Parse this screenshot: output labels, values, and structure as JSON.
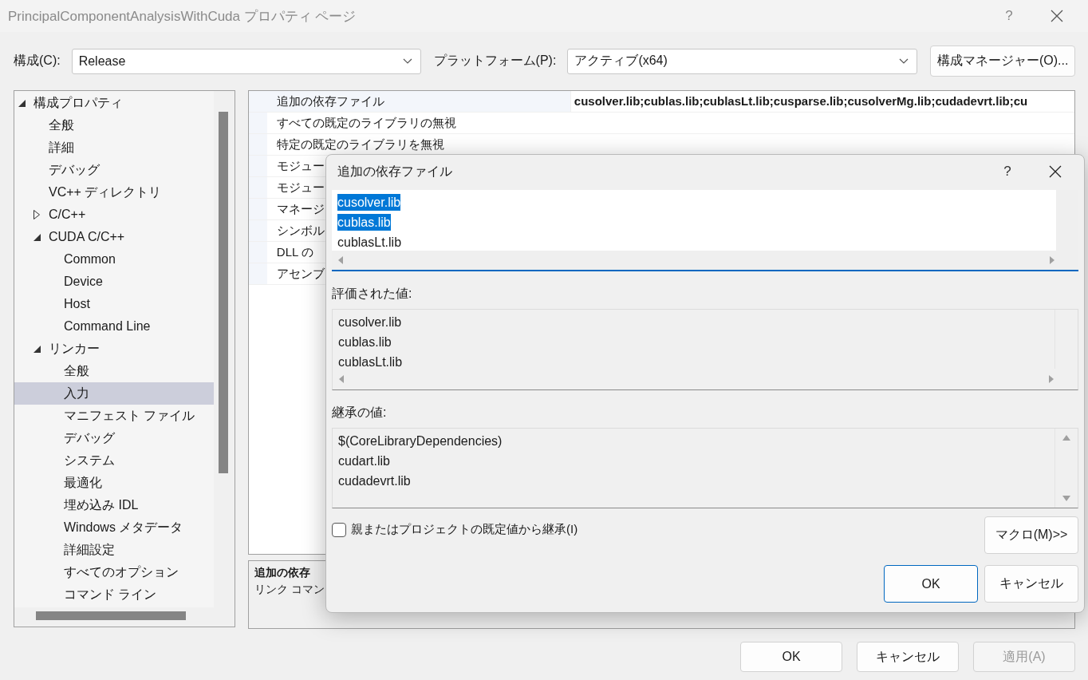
{
  "window": {
    "title": "PrincipalComponentAnalysisWithCuda プロパティ ページ",
    "help": "?"
  },
  "config": {
    "configuration_label": "構成(C):",
    "configuration": "Release",
    "platform_label": "プラットフォーム(P):",
    "platform": "アクティブ(x64)",
    "manager_button": "構成マネージャー(O)..."
  },
  "tree": [
    {
      "label": "構成プロパティ",
      "selected": false,
      "expanded": true,
      "children": [
        {
          "label": "全般",
          "selected": false
        },
        {
          "label": "詳細",
          "selected": false
        },
        {
          "label": "デバッグ",
          "selected": false
        },
        {
          "label": "VC++ ディレクトリ",
          "selected": false
        },
        {
          "label": "C/C++",
          "selected": false,
          "expanded": false
        },
        {
          "label": "CUDA C/C++",
          "selected": false,
          "expanded": true,
          "children": [
            {
              "label": "Common",
              "selected": false
            },
            {
              "label": "Device",
              "selected": false
            },
            {
              "label": "Host",
              "selected": false
            },
            {
              "label": "Command Line",
              "selected": false
            }
          ]
        },
        {
          "label": "リンカー",
          "selected": false,
          "expanded": true,
          "children": [
            {
              "label": "全般",
              "selected": false
            },
            {
              "label": "入力",
              "selected": true
            },
            {
              "label": "マニフェスト ファイル",
              "selected": false
            },
            {
              "label": "デバッグ",
              "selected": false
            },
            {
              "label": "システム",
              "selected": false
            },
            {
              "label": "最適化",
              "selected": false
            },
            {
              "label": "埋め込み IDL",
              "selected": false
            },
            {
              "label": "Windows メタデータ",
              "selected": false
            },
            {
              "label": "詳細設定",
              "selected": false
            },
            {
              "label": "すべてのオプション",
              "selected": false
            },
            {
              "label": "コマンド ライン",
              "selected": false
            }
          ]
        }
      ]
    }
  ],
  "properties": [
    {
      "name": "追加の依存ファイル",
      "value": "cusolver.lib;cublas.lib;cublasLt.lib;cusparse.lib;cusolverMg.lib;cudadevrt.lib;cu",
      "selected": true
    },
    {
      "name": "すべての既定のライブラリの無視",
      "selected": false
    },
    {
      "name": "特定の既定のライブラリを無視",
      "selected": false
    },
    {
      "name": "モジュー",
      "selected": false
    },
    {
      "name": "モジュー",
      "selected": false
    },
    {
      "name": "マネージ",
      "selected": false
    },
    {
      "name": "シンボル",
      "selected": false
    },
    {
      "name": "DLL の",
      "selected": false
    },
    {
      "name": "アセンブ",
      "selected": false
    }
  ],
  "description": {
    "title": "追加の依存",
    "text": "リンク コマン"
  },
  "buttons": [
    {
      "label": "OK",
      "disabled": false
    },
    {
      "label": "キャンセル",
      "disabled": false
    },
    {
      "label": "適用(A)",
      "disabled": true
    }
  ],
  "dialog": {
    "title": "追加の依存ファイル",
    "help": "?",
    "entries": [
      {
        "text": "cusolver.lib",
        "selected": true
      },
      {
        "text": "cublas.lib",
        "selected": true
      },
      {
        "text": "cublasLt.lib",
        "selected": false
      }
    ],
    "evaluated_label": "評価された値:",
    "evaluated": [
      "cusolver.lib",
      "cublas.lib",
      "cublasLt.lib"
    ],
    "inherited_label": "継承の値:",
    "inherited": [
      "$(CoreLibraryDependencies)",
      "cudart.lib",
      "cudadevrt.lib"
    ],
    "inherit_checkbox": {
      "label": "親またはプロジェクトの既定値から継承(I)",
      "checked": false
    },
    "macro_button": "マクロ(M)>>",
    "buttons": [
      {
        "label": "OK",
        "default": true
      },
      {
        "label": "キャンセル",
        "default": false
      }
    ]
  }
}
